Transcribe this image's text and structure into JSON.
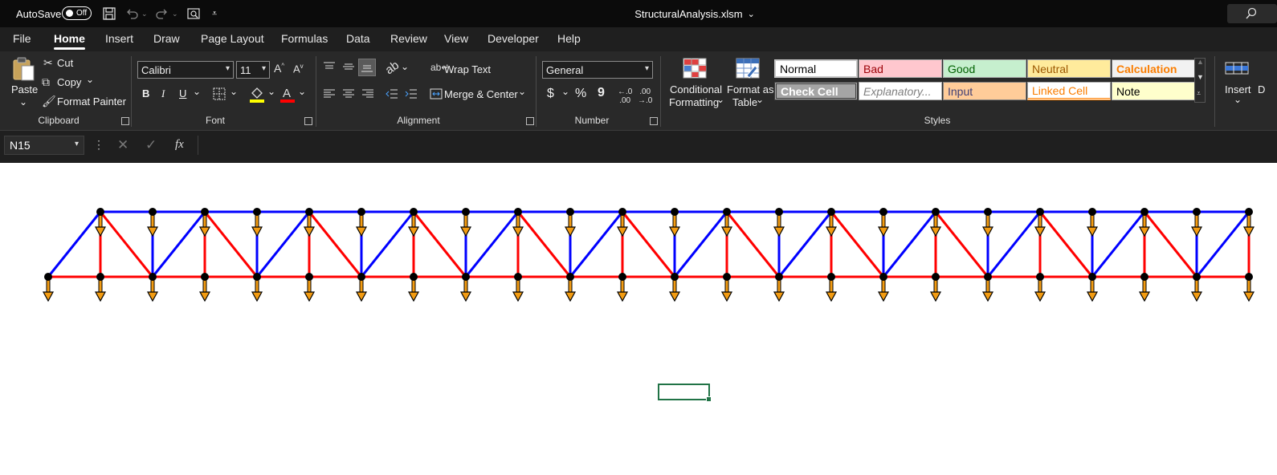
{
  "titlebar": {
    "autosave_label": "AutoSave",
    "autosave_state": "Off",
    "file_title": "StructuralAnalysis.xlsm"
  },
  "menu": {
    "tabs": [
      "File",
      "Home",
      "Insert",
      "Draw",
      "Page Layout",
      "Formulas",
      "Data",
      "Review",
      "View",
      "Developer",
      "Help"
    ],
    "active": "Home"
  },
  "clipboard": {
    "paste": "Paste",
    "cut": "Cut",
    "copy": "Copy",
    "format_painter": "Format Painter",
    "label": "Clipboard"
  },
  "font": {
    "name": "Calibri",
    "size": "11",
    "bold": "B",
    "italic": "I",
    "underline": "U",
    "label": "Font",
    "fill_color": "#ffff00",
    "font_color": "#ff0000"
  },
  "alignment": {
    "wrap_text": "Wrap Text",
    "merge_center": "Merge & Center",
    "label": "Alignment"
  },
  "number": {
    "format": "General",
    "currency": "$",
    "percent": "%",
    "comma": "9",
    "label": "Number"
  },
  "styles": {
    "conditional_formatting_1": "Conditional",
    "conditional_formatting_2": "Formatting",
    "format_as_table_1": "Format as",
    "format_as_table_2": "Table",
    "label": "Styles",
    "cells": {
      "normal": "Normal",
      "bad": "Bad",
      "good": "Good",
      "neutral": "Neutral",
      "calculation": "Calculation",
      "check_cell": "Check Cell",
      "explanatory": "Explanatory...",
      "input": "Input",
      "linked_cell": "Linked Cell",
      "note": "Note"
    }
  },
  "cells_group": {
    "insert": "Insert"
  },
  "formula_bar": {
    "name_box": "N15",
    "fx": "fx",
    "content": ""
  },
  "truss": {
    "panels": 23,
    "top_chord_color": "#0000ff",
    "bottom_chord_color": "#ff0000",
    "node_color": "#000000",
    "load_arrow_color": "#f39c12"
  }
}
